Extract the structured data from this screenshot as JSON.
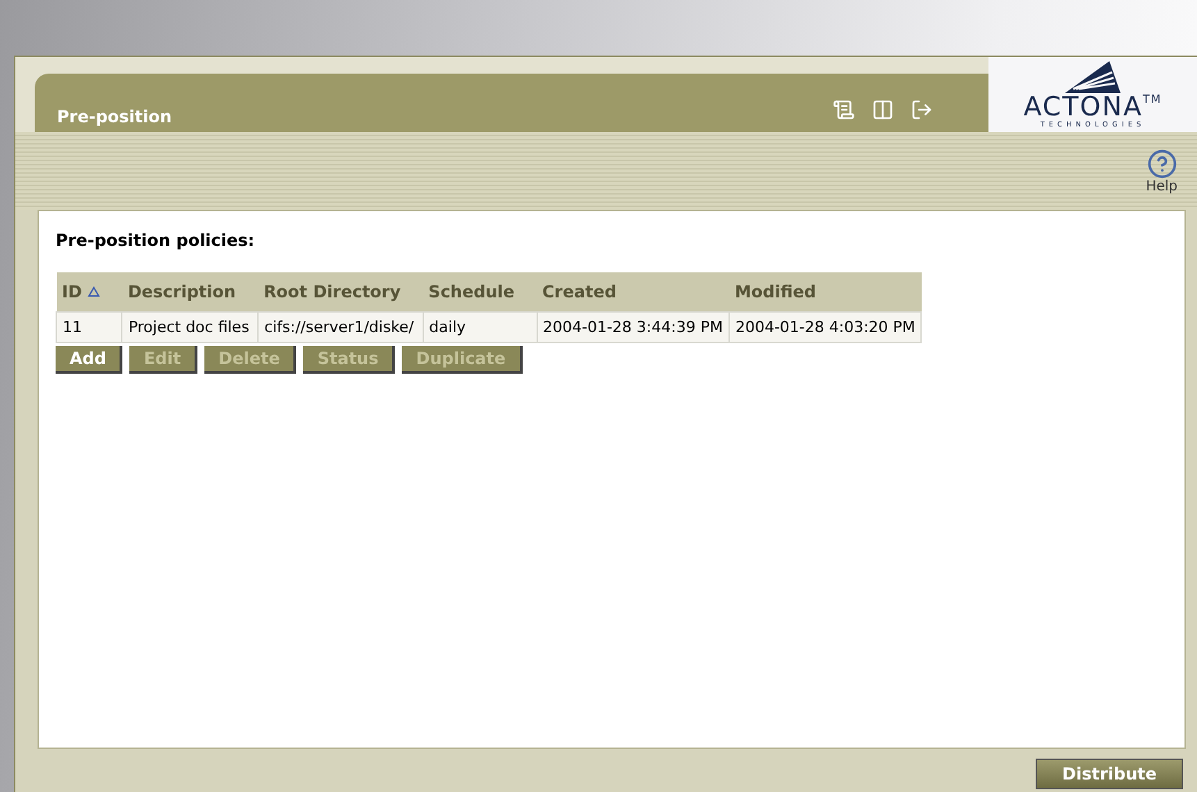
{
  "logo": {
    "name": "ACTONA",
    "trademark": "TM",
    "tagline": "TECHNOLOGIES"
  },
  "header": {
    "title": "Pre-position"
  },
  "toolbar": {
    "help_label": "Help"
  },
  "section_title": "Pre-position policies:",
  "table": {
    "columns": [
      {
        "label": "ID",
        "sorted": true
      },
      {
        "label": "Description",
        "sorted": false
      },
      {
        "label": "Root Directory",
        "sorted": false
      },
      {
        "label": "Schedule",
        "sorted": false
      },
      {
        "label": "Created",
        "sorted": false
      },
      {
        "label": "Modified",
        "sorted": false
      }
    ],
    "rows": [
      [
        "11",
        "Project doc files",
        "cifs://server1/diske/",
        "daily",
        "2004-01-28 3:44:39 PM",
        "2004-01-28 4:03:20 PM"
      ]
    ]
  },
  "buttons": [
    {
      "label": "Add",
      "disabled": false
    },
    {
      "label": "Edit",
      "disabled": true
    },
    {
      "label": "Delete",
      "disabled": true
    },
    {
      "label": "Status",
      "disabled": true
    },
    {
      "label": "Duplicate",
      "disabled": true
    }
  ],
  "footer_button": {
    "label": "Distribute"
  }
}
